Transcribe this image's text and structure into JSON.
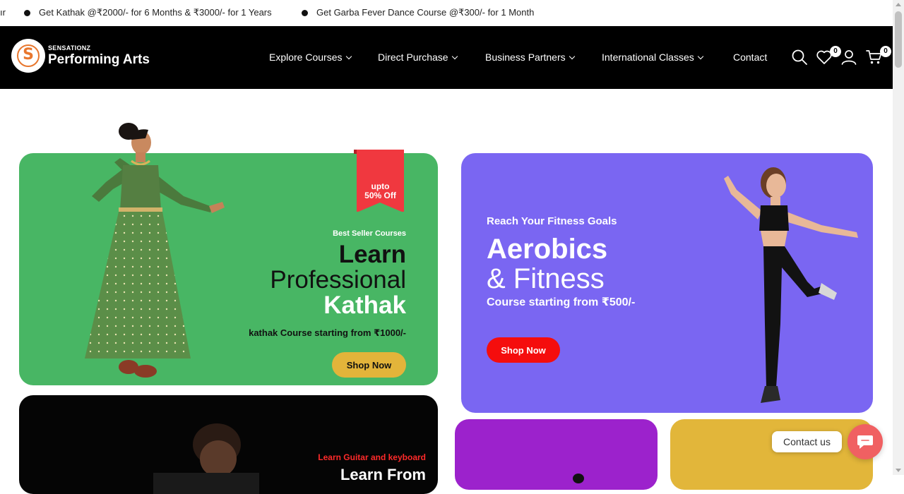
{
  "ticker": {
    "items": [
      "ır",
      "Get Kathak @₹2000/- for 6 Months & ₹3000/- for 1 Years",
      "Get Garba Fever Dance Course @₹300/- for 1 Month"
    ]
  },
  "header": {
    "logo_top": "SENSATIONZ",
    "logo_main": "Performing Arts",
    "nav": [
      {
        "label": "Explore Courses"
      },
      {
        "label": "Direct Purchase"
      },
      {
        "label": "Business Partners"
      },
      {
        "label": "International Classes"
      },
      {
        "label": "Contact"
      }
    ],
    "wishlist_count": "0",
    "cart_count": "0",
    "icons": [
      "search-icon",
      "heart-icon",
      "user-icon",
      "cart-icon"
    ]
  },
  "banners": {
    "kathak": {
      "ribbon": "upto 50% Off",
      "ribbon_line1": "upto",
      "ribbon_line2": "50% Off",
      "tagline": "Best Seller Courses",
      "line1": "Learn",
      "line2": "Professional",
      "line3": "Kathak",
      "subtitle": "kathak Course starting from ₹1000/-",
      "button": "Shop Now"
    },
    "aerobics": {
      "tagline": "Reach Your Fitness Goals",
      "line1": "Aerobics",
      "line2": "& Fitness",
      "subtitle": "Course starting from ₹500/-",
      "button": "Shop Now"
    },
    "guitar": {
      "tagline": "Learn Guitar and keyboard",
      "line1": "Learn From"
    }
  },
  "contact_widget": {
    "label": "Contact us"
  },
  "colors": {
    "kathak_bg": "#48b664",
    "aerobics_bg": "#7a66f2",
    "purple_bg": "#9c22cc",
    "yellow_bg": "#e2b63a",
    "ribbon": "#f0383f",
    "shop_now_yellow": "#e3b43a",
    "shop_now_red": "#f50d0d",
    "header_bg": "#000000"
  }
}
